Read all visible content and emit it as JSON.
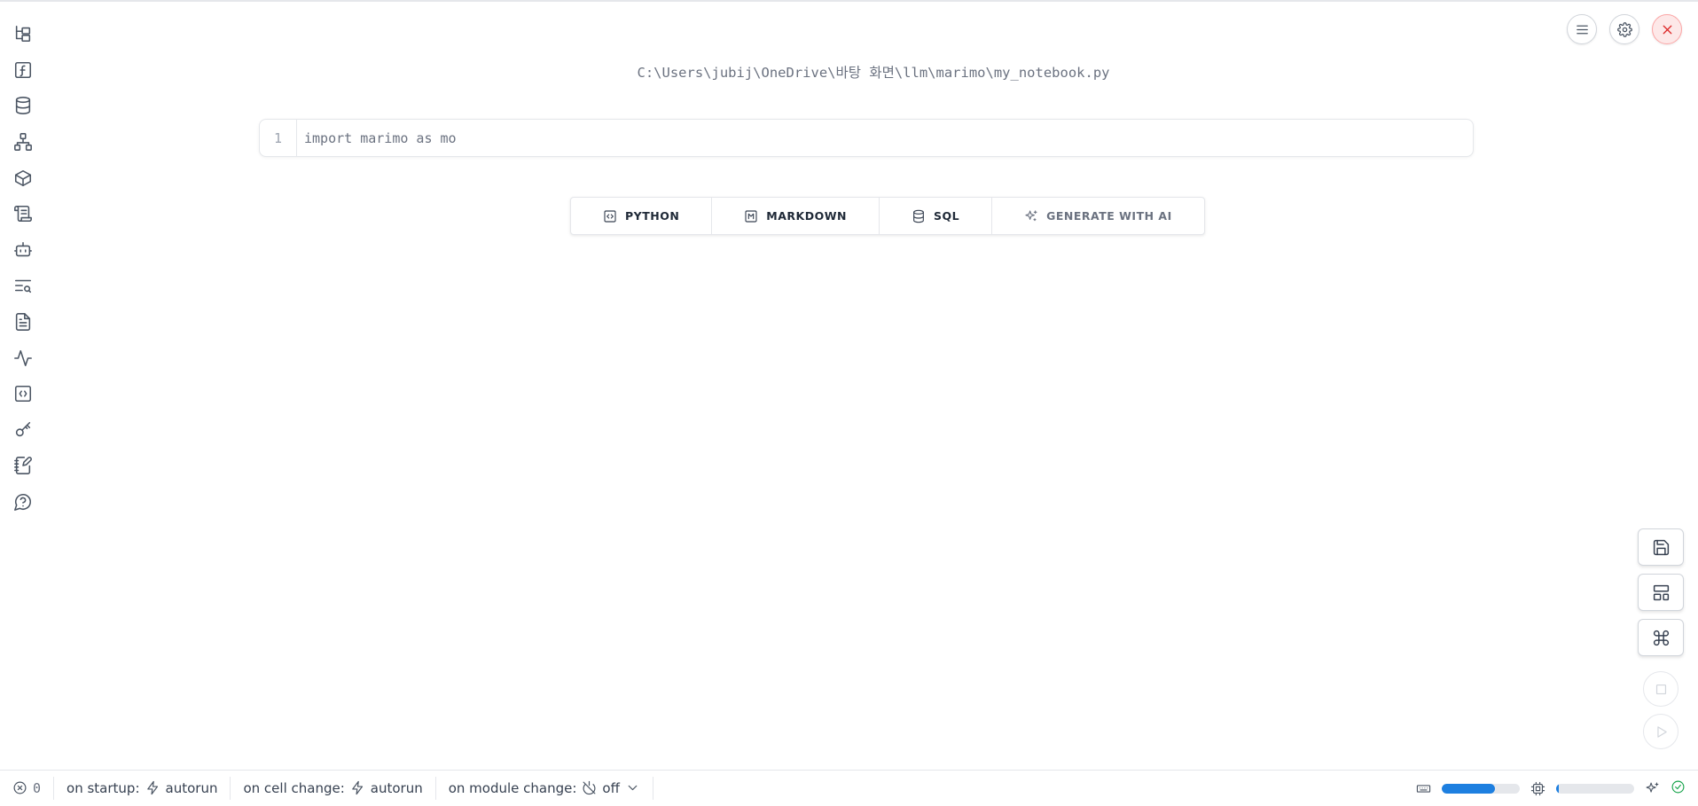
{
  "notebook": {
    "filename": "C:\\Users\\jubij\\OneDrive\\바탕 화면\\llm\\marimo\\my_notebook.py"
  },
  "cell": {
    "line_number": "1",
    "code": "import marimo as mo"
  },
  "add_cell": {
    "python": "PYTHON",
    "markdown": "MARKDOWN",
    "sql": "SQL",
    "ai": "GENERATE WITH AI"
  },
  "sidebar": {
    "icons": [
      "file-tree-icon",
      "function-icon",
      "database-icon",
      "network-icon",
      "package-icon",
      "scroll-icon",
      "bot-icon",
      "text-search-icon",
      "file-text-icon",
      "activity-icon",
      "code-braces-icon",
      "key-icon",
      "notebook-pen-icon",
      "help-circle-icon"
    ]
  },
  "footer": {
    "error_count": "0",
    "startup_label": "on startup:",
    "startup_value": "autorun",
    "cell_change_label": "on cell change:",
    "cell_change_value": "autorun",
    "module_change_label": "on module change:",
    "module_change_value": "off",
    "memory_fraction": 0.68,
    "cpu_fraction": 0.03
  },
  "colors": {
    "accent": "#1d7fe0",
    "close": "#dc2626",
    "ok": "#16a34a"
  }
}
